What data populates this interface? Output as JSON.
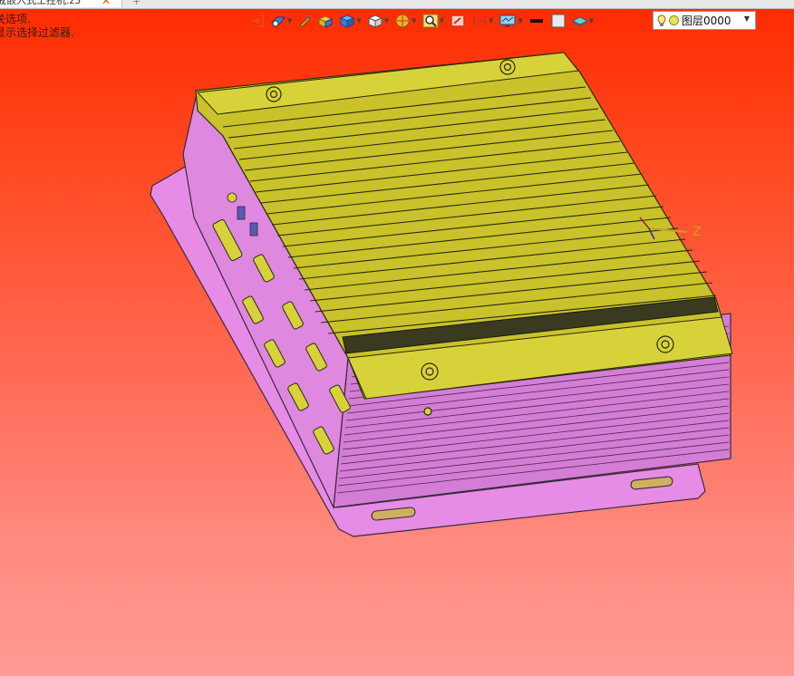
{
  "document_tab": {
    "title": "戒嵌入式工控机.z3",
    "close_glyph": "✕",
    "add_glyph": "+"
  },
  "status": {
    "line1": "关选项.",
    "line2": "显示选择过滤器."
  },
  "toolbar": {
    "tools": [
      {
        "name": "exit-icon",
        "dropdown": false
      },
      {
        "name": "view-filter-icon",
        "dropdown": true
      },
      {
        "name": "pen-icon",
        "dropdown": false
      },
      {
        "name": "box-yellow-icon",
        "dropdown": false
      },
      {
        "name": "cube-blue-icon",
        "dropdown": true
      },
      {
        "name": "cube-white-icon",
        "dropdown": true
      },
      {
        "name": "sphere-icon",
        "dropdown": true
      },
      {
        "name": "zoom-icon",
        "dropdown": true
      },
      {
        "name": "section-icon",
        "dropdown": false
      },
      {
        "name": "dimension-icon",
        "dropdown": true
      },
      {
        "name": "display-icon",
        "dropdown": true
      },
      {
        "name": "line-color-icon",
        "dropdown": false
      },
      {
        "name": "fill-color-icon",
        "dropdown": false
      },
      {
        "name": "layer-stack-icon",
        "dropdown": true
      }
    ]
  },
  "layer": {
    "current": "图层0000",
    "bulb_icon": "lightbulb-icon",
    "color_icon": "layer-color-icon"
  },
  "triad": {
    "z_label": "Z"
  },
  "colors": {
    "background_top": "#ff2a00",
    "background_bottom": "#ff9b93",
    "model_top_fins": "#c9c22a",
    "model_body": "#e88be8",
    "model_edges": "#3a2a3a"
  }
}
